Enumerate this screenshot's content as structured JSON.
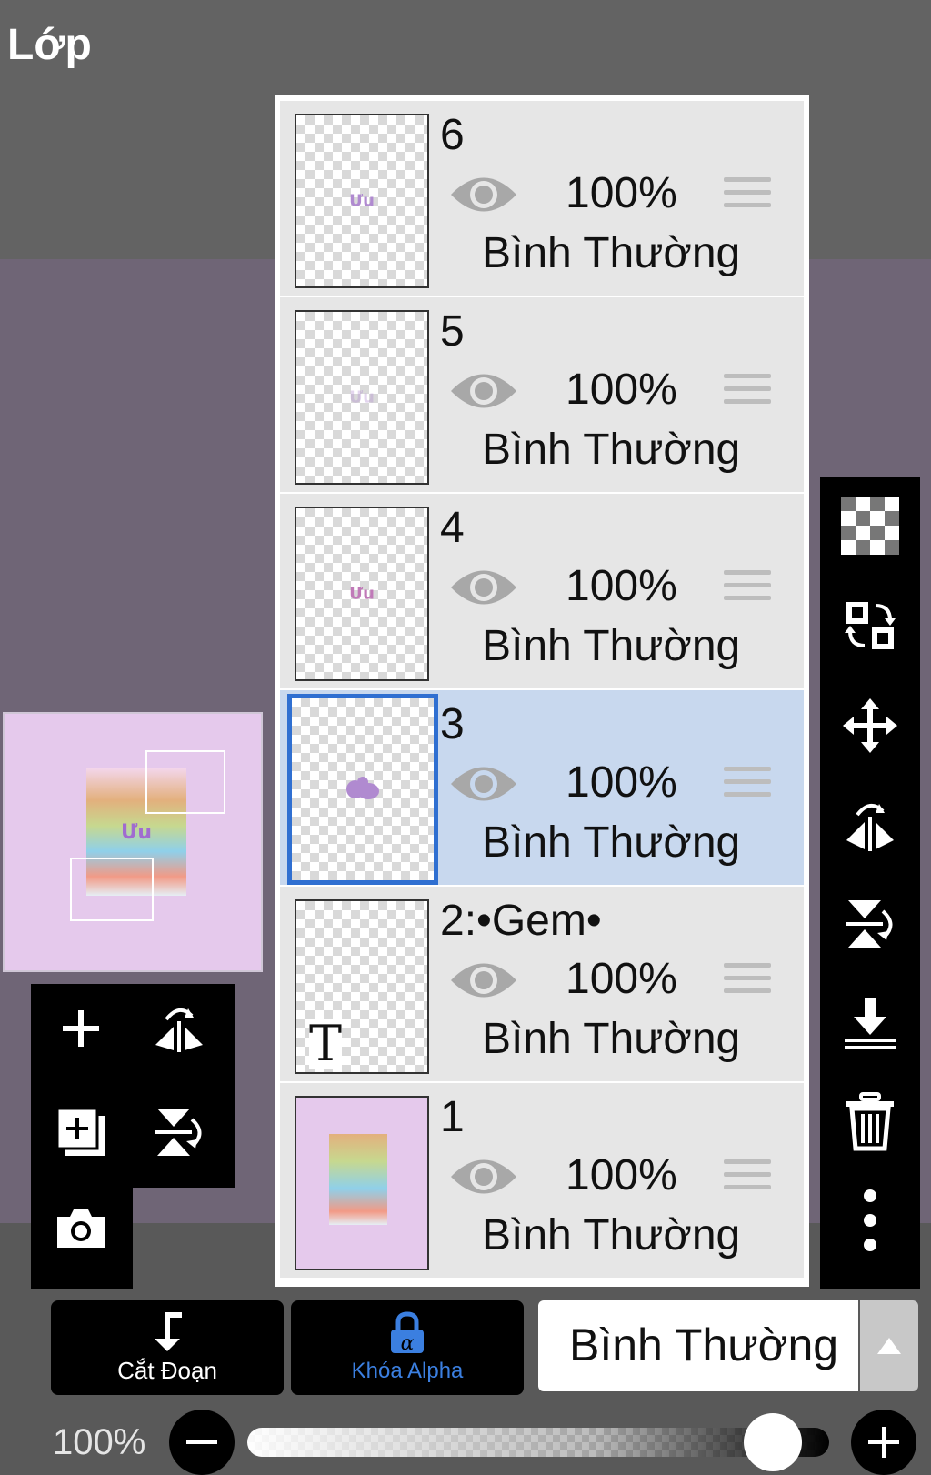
{
  "header": {
    "title": "Lớp"
  },
  "layers": [
    {
      "name": "6",
      "opacity": "100%",
      "mode": "Bình Thường",
      "visible": true,
      "selected": false,
      "thumb": "sticker",
      "thumb_text": "Ưu"
    },
    {
      "name": "5",
      "opacity": "100%",
      "mode": "Bình Thường",
      "visible": true,
      "selected": false,
      "thumb": "sticker-faint",
      "thumb_text": "Ưu"
    },
    {
      "name": "4",
      "opacity": "100%",
      "mode": "Bình Thường",
      "visible": true,
      "selected": false,
      "thumb": "sticker",
      "thumb_text": "Ưu"
    },
    {
      "name": "3",
      "opacity": "100%",
      "mode": "Bình Thường",
      "visible": true,
      "selected": true,
      "thumb": "blob",
      "thumb_text": ""
    },
    {
      "name": "2:•Gem•",
      "opacity": "100%",
      "mode": "Bình Thường",
      "visible": true,
      "selected": false,
      "thumb": "text",
      "thumb_text": "T"
    },
    {
      "name": "1",
      "opacity": "100%",
      "mode": "Bình Thường",
      "visible": true,
      "selected": false,
      "thumb": "photo",
      "thumb_text": ""
    }
  ],
  "bottom": {
    "clip_label": "Cắt Đoạn",
    "alpha_lock_label": "Khóa Alpha",
    "blend_mode": "Bình Thường",
    "opacity_label": "100%",
    "opacity_value": 1.0
  },
  "colors": {
    "accent": "#2f6fd1",
    "alpha_lock": "#3b7fe0",
    "selected_row": "#c8d8ee"
  },
  "icons": {
    "left_tools": [
      "plus-icon",
      "flip-horizontal-icon",
      "add-layer-copy-icon",
      "flip-vertical-icon",
      "camera-icon"
    ],
    "right_tools": [
      "transparency-icon",
      "swap-layers-icon",
      "move-icon",
      "flip-horizontal-icon",
      "flip-vertical-icon",
      "merge-down-icon",
      "trash-icon",
      "more-vertical-icon"
    ]
  }
}
